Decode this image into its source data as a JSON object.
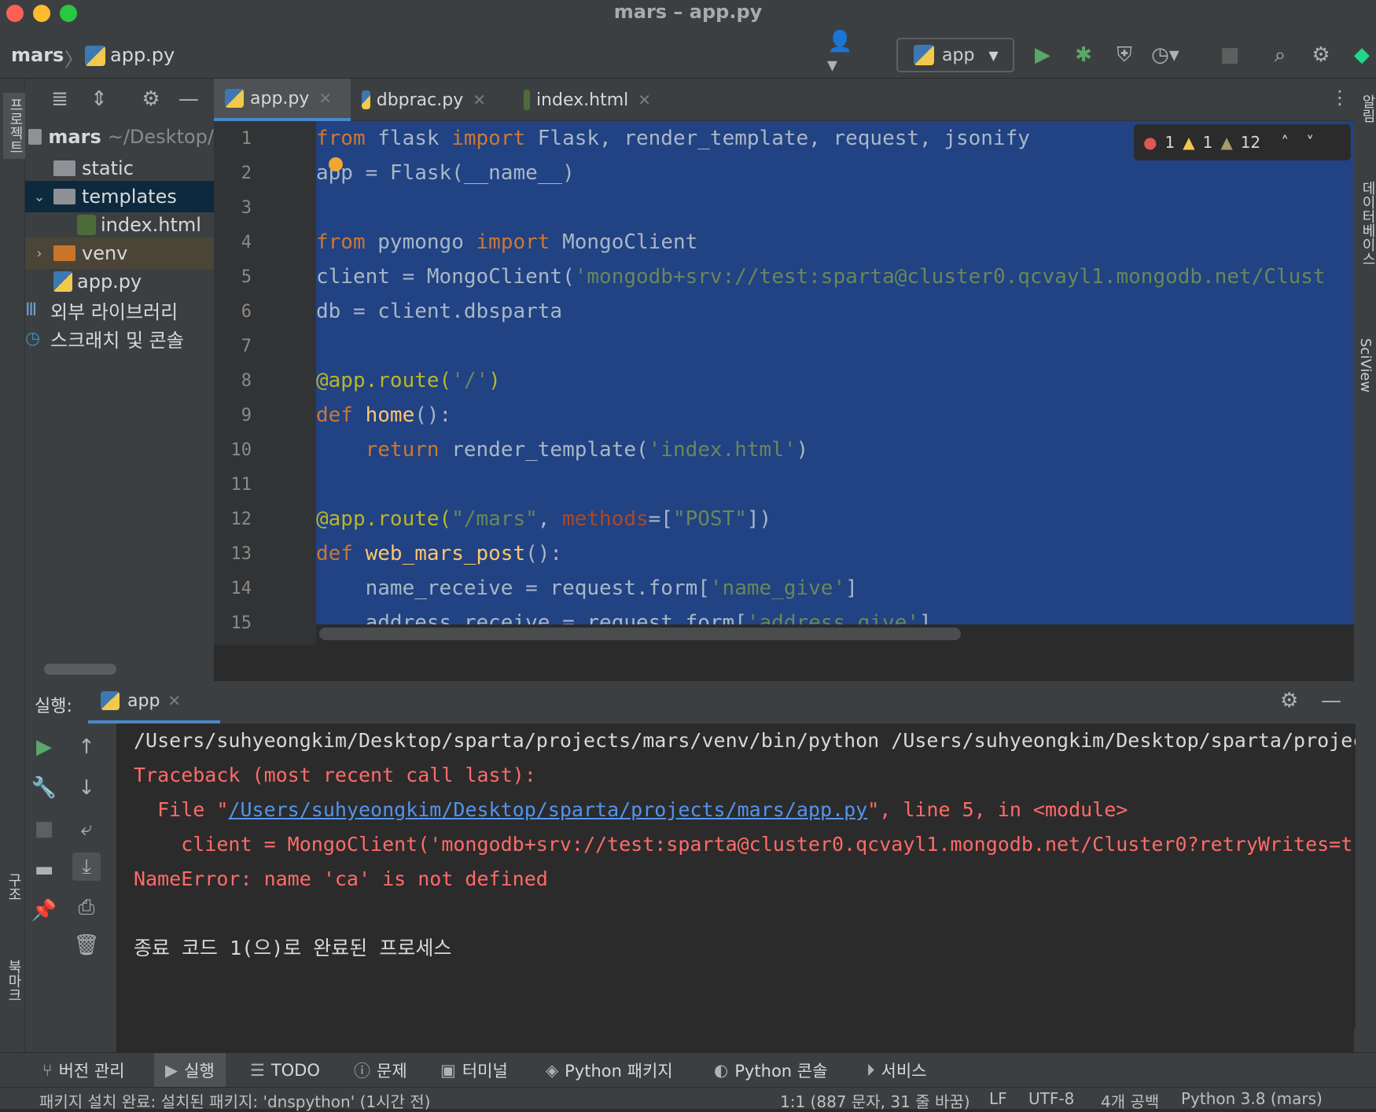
{
  "window": {
    "title": "mars – app.py"
  },
  "breadcrumb": {
    "project": "mars",
    "file": "app.py"
  },
  "run_config": {
    "name": "app"
  },
  "colors": {
    "selection": "#214283",
    "keyword": "#cc7832",
    "string": "#6a8759",
    "decorator": "#bbb529",
    "function": "#ffc66d",
    "error": "#ff6b68",
    "link": "#5394ec",
    "run_green": "#59a869"
  },
  "left_stripe": {
    "project_label": "프로젝트",
    "structure_label": "구조",
    "bookmarks_label": "북마크"
  },
  "right_stripe": {
    "notifications_label": "알림",
    "database_label": "데이터베이스",
    "sciview_label": "SciView"
  },
  "project_tree": {
    "root": {
      "name": "mars",
      "path": "~/Desktop/"
    },
    "items": [
      {
        "label": "static",
        "type": "folder"
      },
      {
        "label": "templates",
        "type": "folder",
        "expanded": true
      },
      {
        "label": "index.html",
        "type": "html-file"
      },
      {
        "label": "venv",
        "type": "venv-folder"
      },
      {
        "label": "app.py",
        "type": "python-file"
      }
    ],
    "external_libraries": "외부 라이브러리",
    "scratches": "스크래치 및 콘솔"
  },
  "editor_tabs": [
    {
      "label": "app.py",
      "active": true
    },
    {
      "label": "dbprac.py",
      "active": false
    },
    {
      "label": "index.html",
      "active": false
    }
  ],
  "inspections": {
    "errors": "1",
    "warnings": "1",
    "weak_warnings": "12"
  },
  "code": {
    "line_numbers": [
      "1",
      "2",
      "3",
      "4",
      "5",
      "6",
      "7",
      "8",
      "9",
      "10",
      "11",
      "12",
      "13",
      "14",
      "15"
    ],
    "l1": {
      "k1": "from",
      "t1": " flask ",
      "k2": "import",
      "t2": " Flask, render_template, request, jsonify"
    },
    "l2": {
      "t": "app = Flask(__name__)"
    },
    "l4": {
      "k1": "from",
      "t1": " pymongo ",
      "k2": "import",
      "t2": " MongoClient"
    },
    "l5": {
      "t": "client = MongoClient(",
      "s": "'mongodb+srv://test:sparta@cluster0.qcvayl1.mongodb.net/Clust"
    },
    "l6": {
      "t": "db = client.dbsparta"
    },
    "l8": {
      "d": "@app.route(",
      "s": "'/'",
      "d2": ")"
    },
    "l9": {
      "k": "def",
      "f": " home",
      "t": "():"
    },
    "l10": {
      "k": "    return",
      "t": " render_template(",
      "s": "'index.html'",
      "t2": ")"
    },
    "l12": {
      "d": "@app.route(",
      "s": "\"/mars\"",
      "t": ", ",
      "p": "methods",
      "t2": "=[",
      "s2": "\"POST\"",
      "t3": "])"
    },
    "l13": {
      "k": "def",
      "f": " web_mars_post",
      "t": "():"
    },
    "l14": {
      "t": "    name_receive = request.form[",
      "s": "'name_give'",
      "t2": "]"
    },
    "l15": {
      "t": "    address_receive = request.form[",
      "s": "'address_give'",
      "t2": "]"
    }
  },
  "run_panel": {
    "label": "실행:",
    "tab": "app"
  },
  "console": {
    "cmd": "/Users/suhyeongkim/Desktop/sparta/projects/mars/venv/bin/python /Users/suhyeongkim/Desktop/sparta/projects/mars/app.py",
    "traceback": "Traceback (most recent call last):",
    "file_prefix": "  File \"",
    "file_link": "/Users/suhyeongkim/Desktop/sparta/projects/mars/app.py",
    "file_suffix": "\", line 5, in <module>",
    "code_line": "    client = MongoClient('mongodb+srv://test:sparta@cluster0.qcvayl1.mongodb.net/Cluster0?retryWrites=true&w=majority', tlsCAFile=ca.where())",
    "error": "NameError: name 'ca' is not defined",
    "exit": "종료 코드 1(으)로 완료된 프로세스"
  },
  "bottom_tabs": [
    {
      "label": "버전 관리",
      "icon": "branch-icon"
    },
    {
      "label": "실행",
      "icon": "play-icon"
    },
    {
      "label": "TODO",
      "icon": "list-icon"
    },
    {
      "label": "문제",
      "icon": "info-icon"
    },
    {
      "label": "터미널",
      "icon": "terminal-icon"
    },
    {
      "label": "Python 패키지",
      "icon": "layers-icon"
    },
    {
      "label": "Python 콘솔",
      "icon": "python-icon"
    },
    {
      "label": "서비스",
      "icon": "services-icon"
    }
  ],
  "status": {
    "message": "패키지 설치 완료: 설치된 패키지: 'dnspython' (1시간 전)",
    "position": "1:1 (887 문자, 31 줄 바꿈)",
    "line_sep": "LF",
    "encoding": "UTF-8",
    "indent": "4개 공백",
    "interpreter": "Python 3.8 (mars)"
  }
}
